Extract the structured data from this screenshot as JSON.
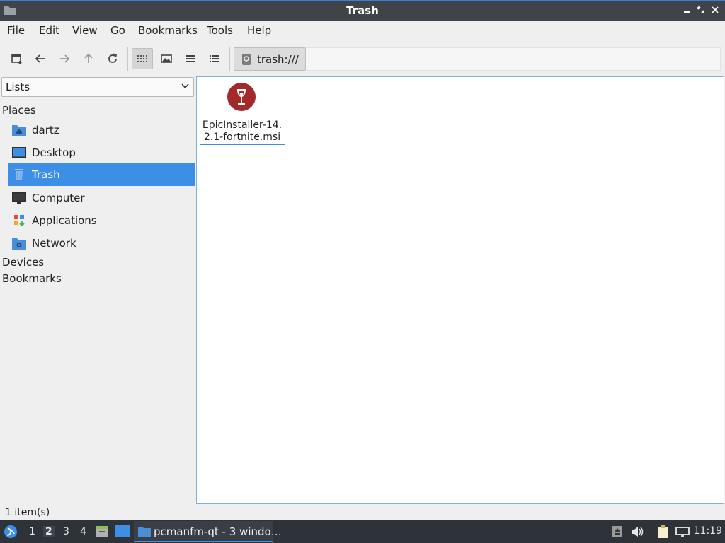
{
  "window": {
    "title": "Trash",
    "controls": [
      "minimize-icon",
      "restore-icon",
      "close-icon"
    ]
  },
  "menubar": {
    "items": [
      "File",
      "Edit",
      "View",
      "Go",
      "Bookmarks",
      "Tools",
      "Help"
    ]
  },
  "toolbar": {
    "buttons": [
      "new-tab-icon",
      "back-icon",
      "forward-icon",
      "up-icon",
      "reload-icon",
      "icon-view-icon",
      "thumbnail-view-icon",
      "compact-view-icon",
      "detailed-list-view-icon"
    ],
    "path": "trash:///"
  },
  "sidebar": {
    "mode": "Lists",
    "places_label": "Places",
    "places": [
      {
        "label": "dartz",
        "icon": "home-folder-icon"
      },
      {
        "label": "Desktop",
        "icon": "desktop-icon"
      },
      {
        "label": "Trash",
        "icon": "trash-icon",
        "selected": true
      },
      {
        "label": "Computer",
        "icon": "computer-icon"
      },
      {
        "label": "Applications",
        "icon": "applications-icon"
      },
      {
        "label": "Network",
        "icon": "network-folder-icon"
      }
    ],
    "devices_label": "Devices",
    "bookmarks_label": "Bookmarks"
  },
  "files": [
    {
      "name": "EpicInstaller-14.2.1-fortnite.msi",
      "icon": "wine-msi-icon"
    }
  ],
  "status": {
    "text": "1 item(s)"
  },
  "taskbar": {
    "workspaces": [
      "1",
      "2",
      "3",
      "4"
    ],
    "current_workspace": "2",
    "task_label": "pcmanfm-qt - 3 windo…",
    "clock": "11:19"
  },
  "colors": {
    "accent": "#3d8ee5",
    "titlebar": "#404348",
    "taskbar": "#2e3239",
    "wine_icon": "#a32a2a"
  }
}
